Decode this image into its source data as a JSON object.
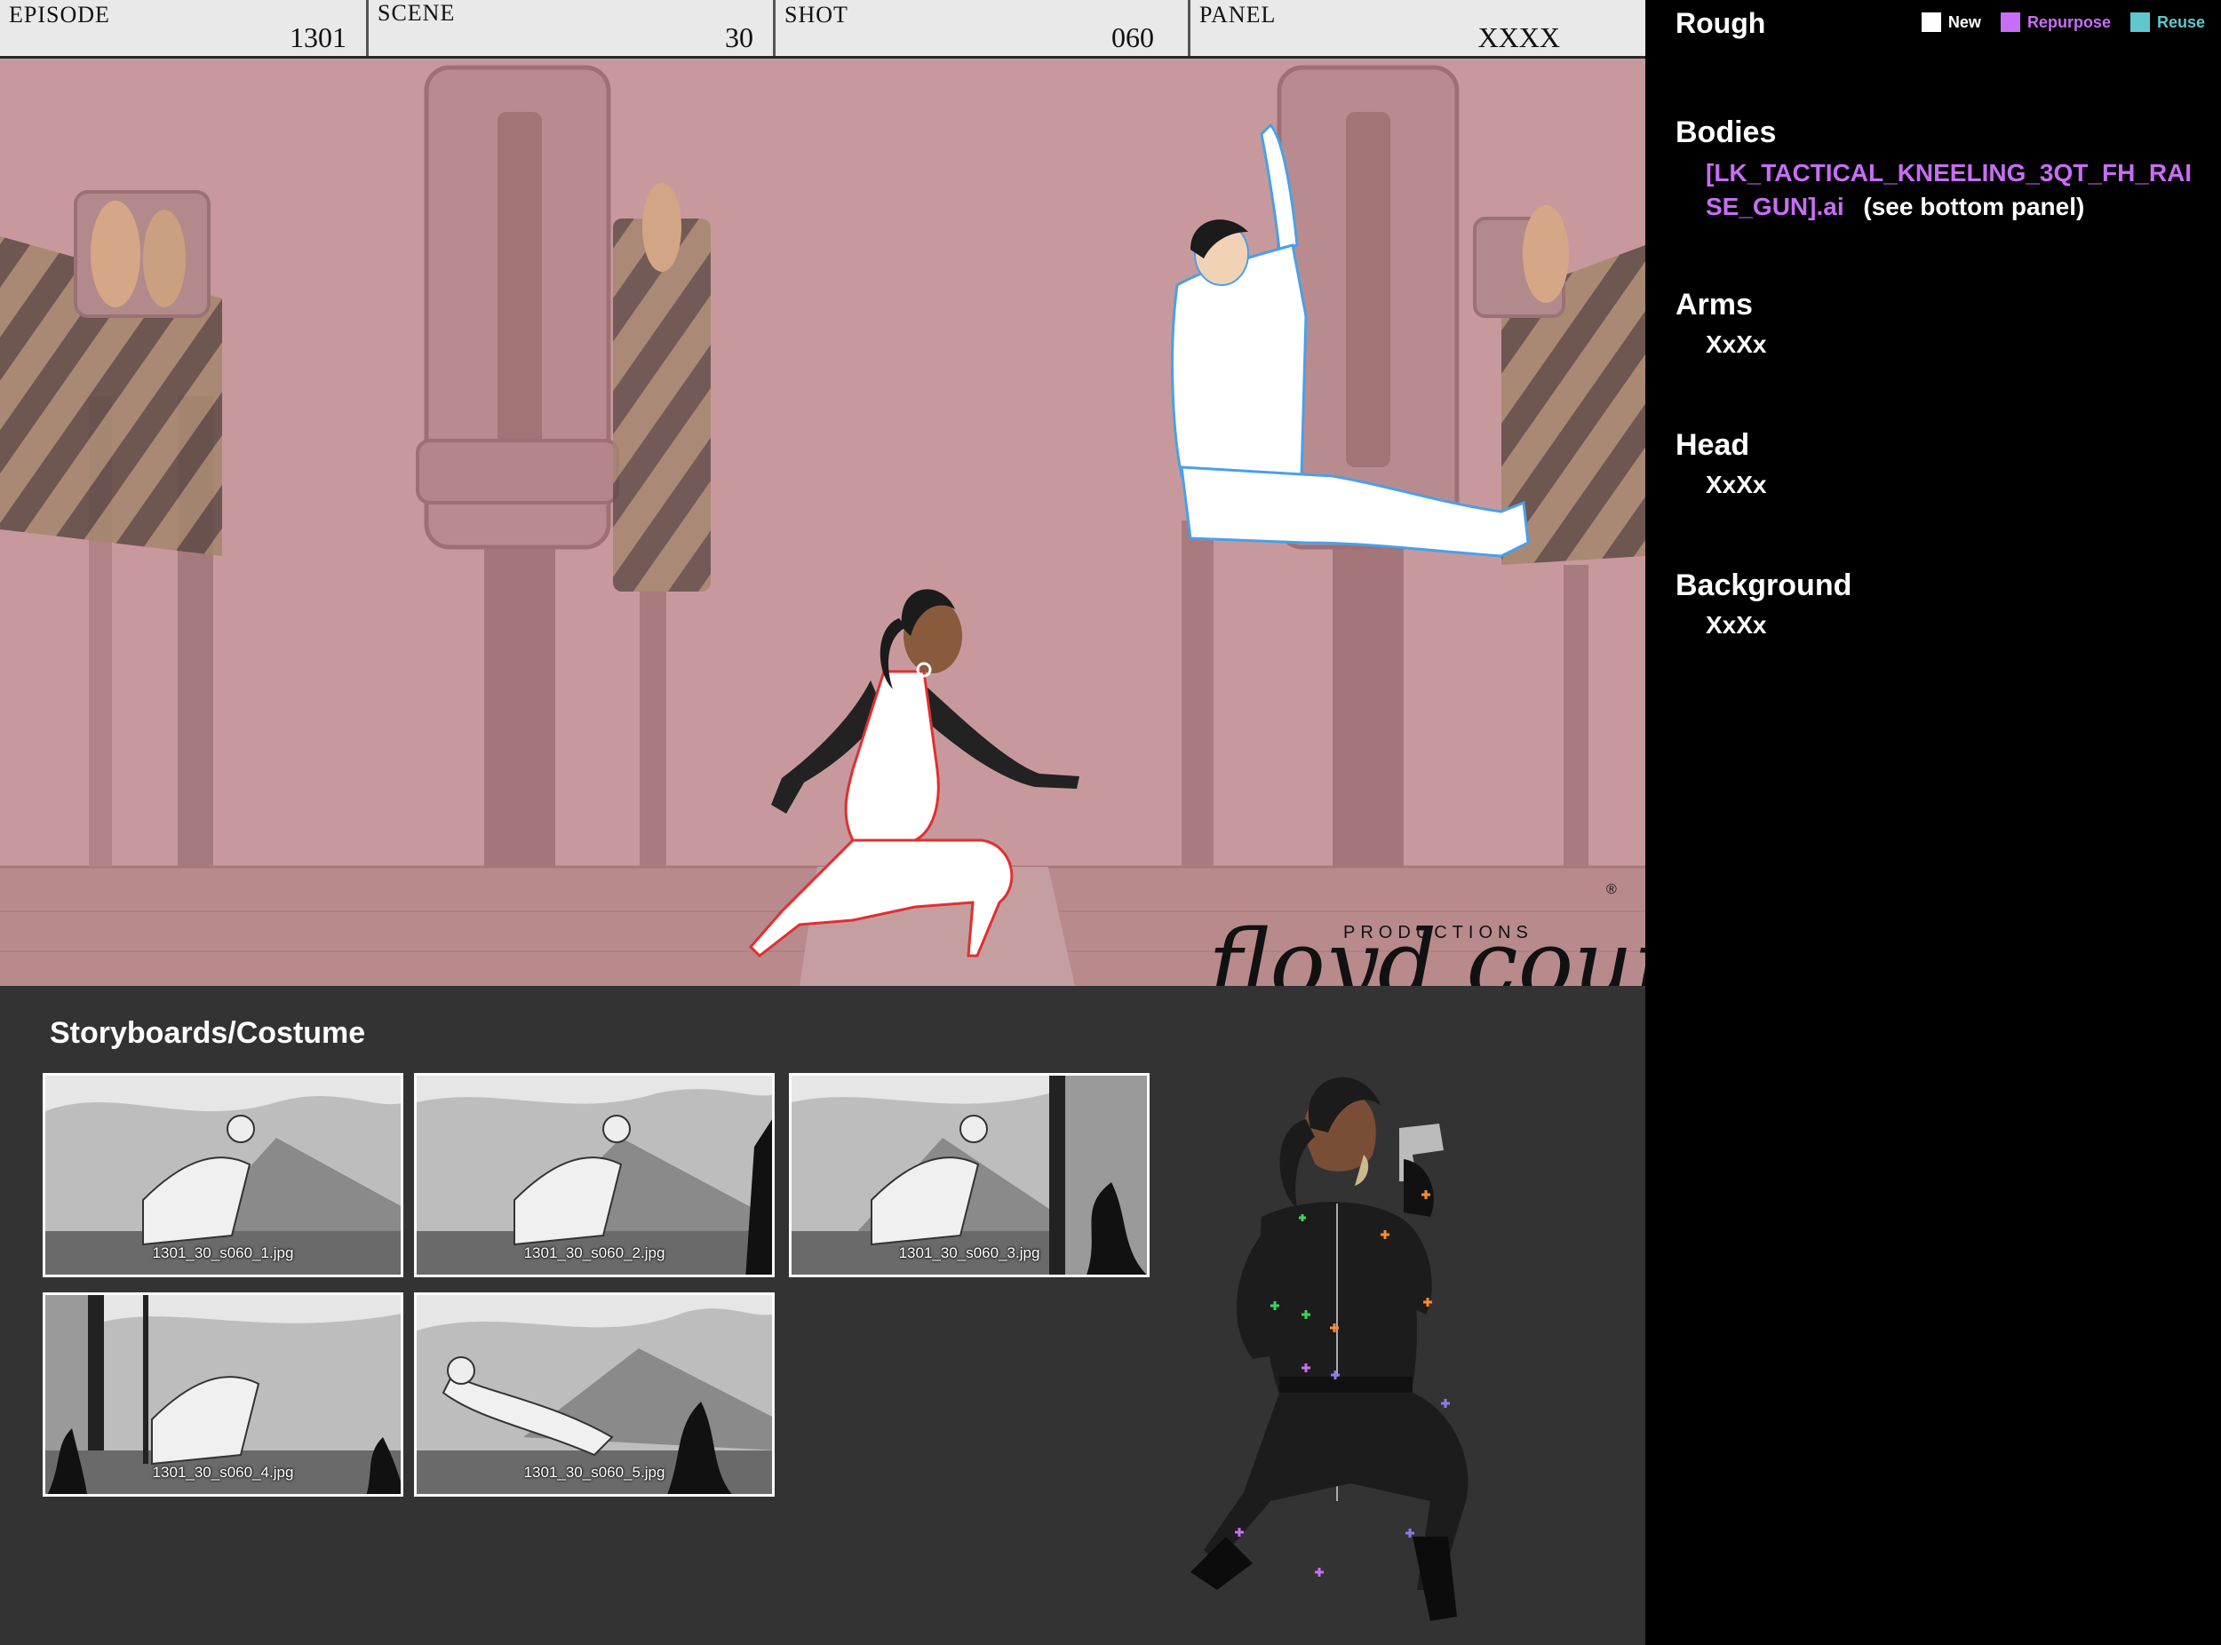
{
  "header": {
    "episode_label": "EPISODE",
    "episode_value": "1301",
    "scene_label": "SCENE",
    "scene_value": "30",
    "shot_label": "SHOT",
    "shot_value": "060",
    "panel_label": "PANEL",
    "panel_value": "XXXX"
  },
  "logo": {
    "script": "floyd county",
    "sub": "PRODUCTIONS",
    "mark": "®"
  },
  "storyboards": {
    "title": "Storyboards/Costume",
    "thumbnails": [
      {
        "caption": "1301_30_s060_1.jpg"
      },
      {
        "caption": "1301_30_s060_2.jpg"
      },
      {
        "caption": "1301_30_s060_3.jpg"
      },
      {
        "caption": "1301_30_s060_4.jpg"
      },
      {
        "caption": "1301_30_s060_5.jpg"
      }
    ]
  },
  "info": {
    "rough": "Rough",
    "legend": [
      {
        "label": "New",
        "color": "#ffffff"
      },
      {
        "label": "Repurpose",
        "color": "#c86df5"
      },
      {
        "label": "Reuse",
        "color": "#5fc8cf"
      }
    ],
    "bodies_title": "Bodies",
    "bodies_file": "[LK_TACTICAL_KNEELING_3QT_FH_RAISE_GUN].ai",
    "bodies_note": "(see bottom panel)",
    "arms_title": "Arms",
    "arms_value": "XxXx",
    "head_title": "Head",
    "head_value": "XxXx",
    "background_title": "Background",
    "background_value": "XxXx"
  },
  "colors": {
    "scene_bg": "#c8999c",
    "accent_purple": "#c86df5",
    "accent_teal": "#5fc8cf"
  }
}
